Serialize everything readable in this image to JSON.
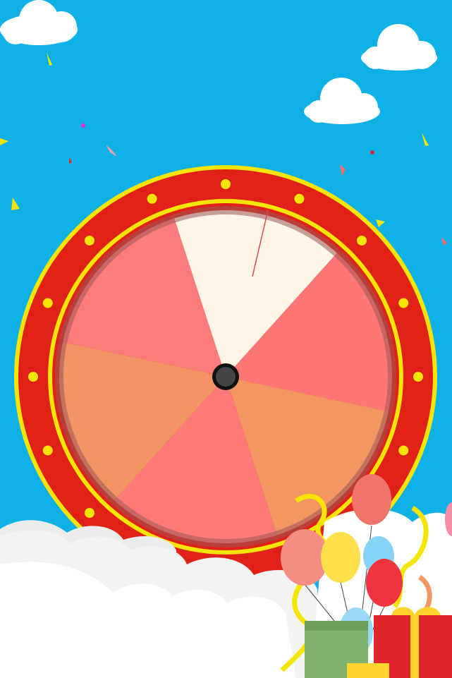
{
  "scene": {
    "background_color": "#0eb1e6",
    "accent_red": "#e02117",
    "accent_yellow": "#f6e500",
    "hub_color": "#333333"
  },
  "wheel": {
    "rim_color": "#e02117",
    "trim_color": "#f6e500",
    "bulb_color": "#f6e500",
    "segment_count": 6,
    "segments": [
      {
        "name": "segment-cream",
        "color": "#fff6e6"
      },
      {
        "name": "segment-pink-a",
        "color": "#ff7676"
      },
      {
        "name": "segment-orange-a",
        "color": "#f39661"
      },
      {
        "name": "segment-pink-b",
        "color": "#ff7a78"
      },
      {
        "name": "segment-orange-b",
        "color": "#f39563"
      },
      {
        "name": "segment-pink-c",
        "color": "#fd7b7a"
      }
    ]
  },
  "balloons": [
    {
      "name": "balloon-red",
      "color": "#f0746c"
    },
    {
      "name": "balloon-peach",
      "color": "#f58d83"
    },
    {
      "name": "balloon-yellow",
      "color": "#ffe04b"
    },
    {
      "name": "balloon-blue",
      "color": "#86d4f5"
    },
    {
      "name": "balloon-crimson",
      "color": "#f0343f"
    },
    {
      "name": "balloon-light-blue",
      "color": "#9ad9f6"
    }
  ],
  "gifts": [
    {
      "name": "gift-green",
      "color": "#7fb36b"
    },
    {
      "name": "gift-red",
      "color": "#e0262b"
    },
    {
      "name": "gift-yellow",
      "color": "#ffd32e"
    }
  ]
}
